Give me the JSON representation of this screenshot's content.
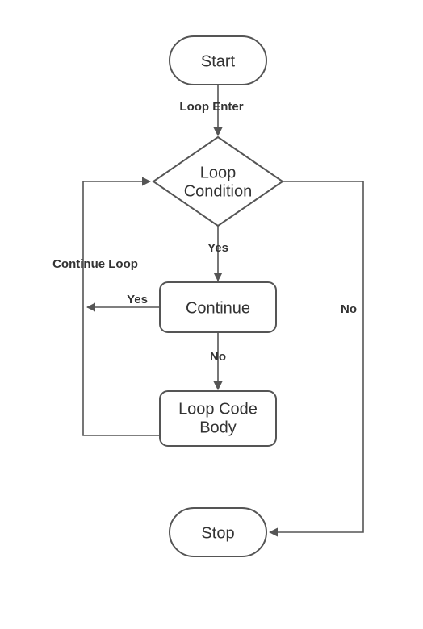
{
  "diagram": {
    "type": "flowchart",
    "nodes": {
      "start": {
        "label": "Start",
        "shape": "terminator"
      },
      "condition": {
        "label_line1": "Loop",
        "label_line2": "Condition",
        "shape": "decision"
      },
      "continue": {
        "label": "Continue",
        "shape": "process"
      },
      "body": {
        "label_line1": "Loop Code",
        "label_line2": "Body",
        "shape": "process"
      },
      "stop": {
        "label": "Stop",
        "shape": "terminator"
      }
    },
    "edges": {
      "start_to_condition": {
        "label": "Loop Enter"
      },
      "condition_to_continue": {
        "label": "Yes"
      },
      "continue_to_body": {
        "label": "No"
      },
      "continue_to_loopback": {
        "label": "Yes"
      },
      "body_to_condition_loop": {
        "label": "Continue Loop"
      },
      "condition_to_stop": {
        "label": "No"
      }
    }
  }
}
